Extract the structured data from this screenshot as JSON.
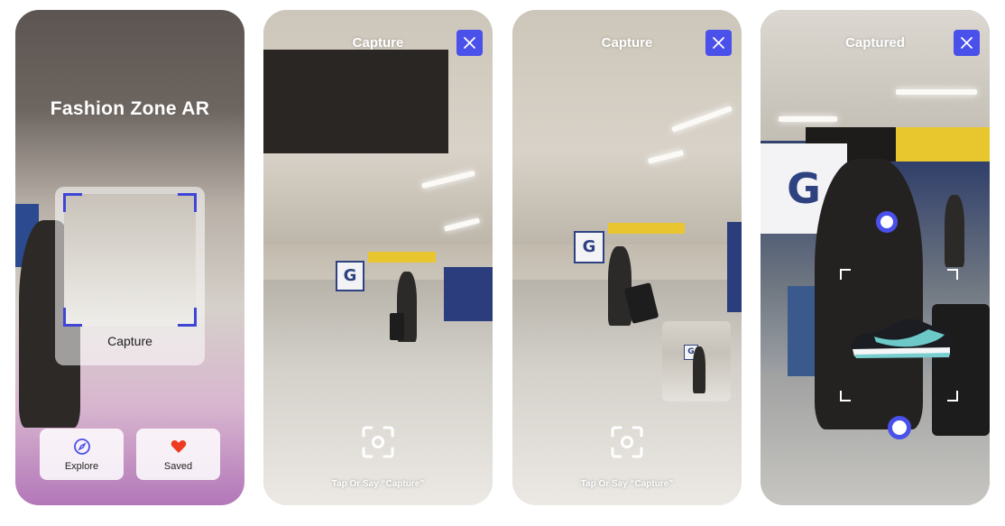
{
  "screens": [
    {
      "title": "Fashion Zone AR",
      "frame_label": "Capture",
      "tabs": [
        {
          "label": "Explore",
          "icon": "compass-icon"
        },
        {
          "label": "Saved",
          "icon": "heart-icon"
        }
      ]
    },
    {
      "header": "Capture",
      "close_icon": "close-icon",
      "capture_icon": "camera-focus-icon",
      "hint": "Tap Or Say “Capture”"
    },
    {
      "header": "Capture",
      "close_icon": "close-icon",
      "capture_icon": "camera-focus-icon",
      "hint": "Tap Or Say “Capture”"
    },
    {
      "header": "Captured",
      "close_icon": "close-icon"
    }
  ],
  "colors": {
    "accent": "#4a50ea",
    "heart": "#ee3b1f",
    "text_light": "#ffffff"
  }
}
